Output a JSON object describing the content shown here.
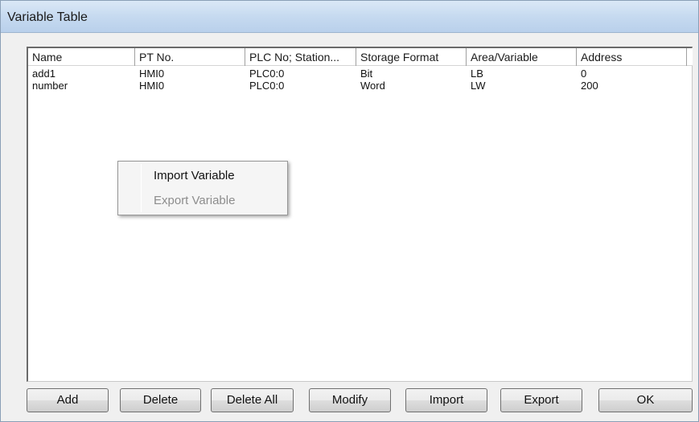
{
  "window": {
    "title": "Variable Table"
  },
  "table": {
    "columns": [
      "Name",
      "PT No.",
      "PLC No; Station...",
      "Storage Format",
      "Area/Variable",
      "Address"
    ],
    "rows": [
      [
        "add1",
        "HMI0",
        "PLC0:0",
        "Bit",
        "LB",
        "0"
      ],
      [
        "number",
        "HMI0",
        "PLC0:0",
        "Word",
        "LW",
        "200"
      ]
    ]
  },
  "context_menu": {
    "items": [
      {
        "label": "Import Variable",
        "enabled": true
      },
      {
        "label": "Export Variable",
        "enabled": false
      }
    ]
  },
  "buttons": {
    "add": "Add",
    "delete": "Delete",
    "delete_all": "Delete All",
    "modify": "Modify",
    "import": "Import",
    "export": "Export",
    "ok": "OK"
  }
}
